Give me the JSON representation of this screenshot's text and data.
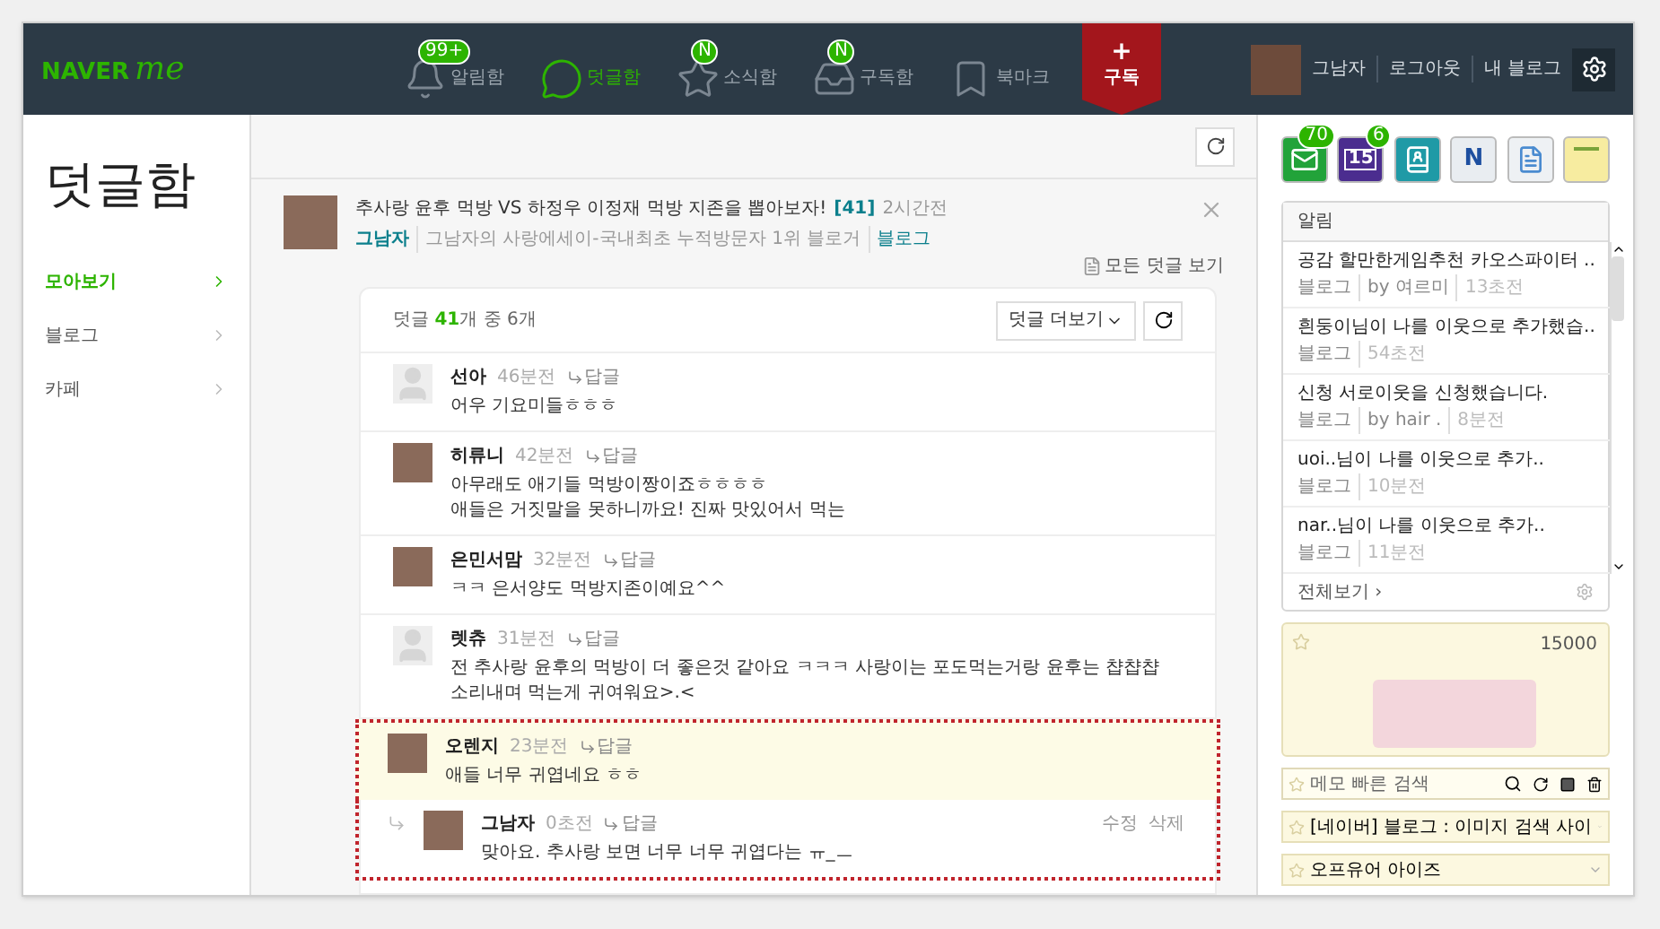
{
  "header": {
    "logo_main": "NAVER",
    "logo_sub": "me",
    "nav": [
      {
        "label": "알림함",
        "badge": "99+",
        "selected": false
      },
      {
        "label": "덧글함",
        "selected": true
      },
      {
        "label": "소식함",
        "badge": "N",
        "selected": false
      },
      {
        "label": "구독함",
        "badge": "N",
        "selected": false
      },
      {
        "label": "북마크",
        "selected": false
      }
    ],
    "subscribe_icon": "+",
    "subscribe_label": "구독",
    "user": {
      "name": "그남자",
      "links": [
        "로그아웃",
        "내 블로그"
      ]
    }
  },
  "sidebar": {
    "title": "덧글함",
    "items": [
      {
        "label": "모아보기",
        "selected": true
      },
      {
        "label": "블로그",
        "selected": false
      },
      {
        "label": "카페",
        "selected": false
      }
    ]
  },
  "post": {
    "title": "추사랑 윤후 먹방 VS 하정우 이정재 먹방 지존을 뽑아보자!",
    "count": "[41]",
    "time": "2시간전",
    "author": "그남자",
    "blog": "그남자의 사랑에세이-국내최초 누적방문자 1위 블로거",
    "source": "블로그",
    "all_comments": "모든 덧글 보기"
  },
  "comments_box": {
    "prefix": "덧글",
    "total": "41",
    "suffix": "개 중 6개",
    "more": "덧글 더보기",
    "comments": [
      {
        "kind": "default",
        "name": "선아",
        "time": "46분전",
        "reply": "답글",
        "text": "어우 기요미들ㅎㅎㅎ",
        "highlighted": false,
        "is_reply": false
      },
      {
        "kind": "photo",
        "name": "히류니",
        "time": "42분전",
        "reply": "답글",
        "text": "아무래도 애기들 먹방이짱이죠ㅎㅎㅎㅎ\n애들은 거짓말을 못하니까요! 진짜 맛있어서 먹는",
        "highlighted": false,
        "is_reply": false
      },
      {
        "kind": "photo",
        "name": "은민서맘",
        "time": "32분전",
        "reply": "답글",
        "text": "ㅋㅋ 은서양도 먹방지존이예요^^",
        "highlighted": false,
        "is_reply": false
      },
      {
        "kind": "default",
        "name": "렛츄",
        "time": "31분전",
        "reply": "답글",
        "text": "전 추사랑 윤후의 먹방이 더 좋은것 같아요 ㅋㅋㅋ 사랑이는 포도먹는거랑 윤후는 챱챱챱 소리내며 먹는게 귀여워요>.<",
        "highlighted": false,
        "is_reply": false
      },
      {
        "kind": "photo",
        "name": "오렌지",
        "time": "23분전",
        "reply": "답글",
        "text": "애들 너무 귀엽네요 ㅎㅎ",
        "highlighted": true,
        "is_reply": false
      },
      {
        "kind": "photo",
        "name": "그남자",
        "time": "0초전",
        "reply": "답글",
        "text": "맞아요. 추사랑 보면 너무 너무 귀엽다는 ㅠ_ㅡ",
        "highlighted": false,
        "is_reply": true,
        "actions": [
          "수정",
          "삭제"
        ]
      }
    ]
  },
  "widgets": [
    {
      "kind": "mail",
      "badge": "70",
      "color": "#22a33a"
    },
    {
      "kind": "calendar",
      "text": "15",
      "badge": "6",
      "color": "#4b2d8f"
    },
    {
      "kind": "contacts",
      "color": "#1f9aa6"
    },
    {
      "kind": "n",
      "text": "N",
      "color": "#e9edf1"
    },
    {
      "kind": "doc",
      "color": "#eef1f4"
    },
    {
      "kind": "memo",
      "color": "#f7eca0"
    }
  ],
  "alerts": {
    "title": "알림",
    "items": [
      {
        "title": "공감 할만한게임추천 카오스파이터 ..",
        "source": "블로그",
        "by": "by 여르미",
        "time": "13초전"
      },
      {
        "title": "흰둥이님이 나를 이웃으로 추가했습..",
        "source": "블로그",
        "time": "54초전"
      },
      {
        "title": "신청  서로이웃을 신청했습니다.",
        "source": "블로그",
        "by": "by hair .",
        "time": "8분전"
      },
      {
        "title": "uoi..님이 나를 이웃으로 추가..",
        "source": "블로그",
        "time": "10분전"
      },
      {
        "title": "nar..님이 나를 이웃으로 추가..",
        "source": "블로그",
        "time": "11분전"
      }
    ],
    "footer": "전체보기 ›"
  },
  "memo": {
    "count": "15000",
    "search_placeholder": "메모 빠른 검색",
    "items": [
      "[네이버] 블로그 : 이미지 검색 사이",
      "오프유어 아이즈"
    ]
  }
}
